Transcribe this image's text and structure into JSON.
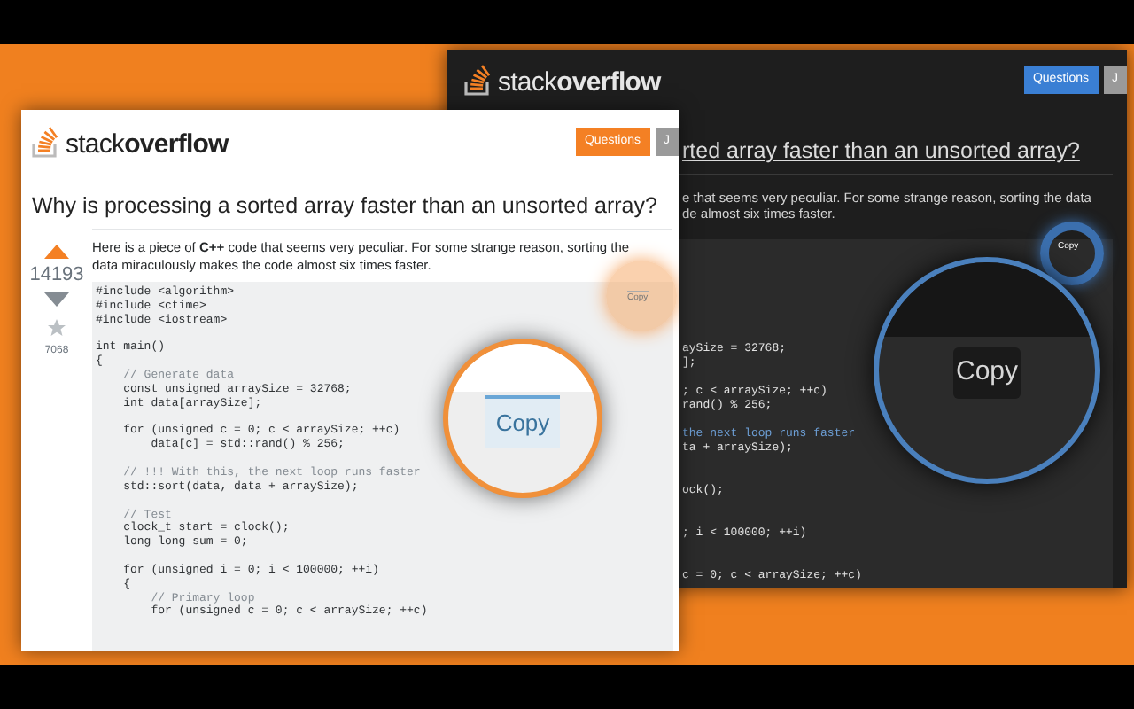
{
  "dark_window": {
    "logo": "stack**overflow**",
    "nav_buttons": [
      {
        "label": "Questions",
        "selected": true
      },
      {
        "label": "J",
        "selected": false
      }
    ],
    "question_title": "rted array faster than an unsorted array?",
    "question_body": [
      "e that seems very peculiar. For some strange reason, sorting the data",
      "de almost six times faster."
    ],
    "copy_button": "Copy",
    "magnified_copy_button": "Copy",
    "code_fragments": [
      {
        "text": "aySize = 32768;",
        "kind": "code"
      },
      {
        "text": "];",
        "kind": "code"
      },
      {
        "text": "; c < arraySize; ++c)",
        "kind": "code"
      },
      {
        "text": "rand() % 256;",
        "kind": "code"
      },
      {
        "text": "the next loop runs faster",
        "kind": "comment"
      },
      {
        "text": "ta + arraySize);",
        "kind": "code"
      },
      {
        "text": "ock();",
        "kind": "code"
      },
      {
        "text": "; i < 100000; ++i)",
        "kind": "code"
      },
      {
        "text": "c = 0; c < arraySize; ++c)",
        "kind": "code"
      }
    ]
  },
  "light_window": {
    "logo": "stack**overflow**",
    "nav_buttons": [
      {
        "label": "Questions",
        "selected": true
      },
      {
        "label": "J",
        "selected": false
      }
    ],
    "question_title": "Why is processing a sorted array faster than an unsorted array?",
    "votes": {
      "score": "14193",
      "upvoted": true,
      "downvoted": false,
      "favorited": false,
      "favorites": "7068"
    },
    "question_body": "Here is a piece of **C++** code that seems very peculiar. For some strange reason, sorting the data miraculously makes the code almost six times faster.",
    "copy_button": "Copy",
    "magnified_copy_button": "Copy",
    "code_blocks": [
      [
        {
          "text": "#include <algorithm>",
          "kind": "code"
        },
        {
          "text": "#include <ctime>",
          "kind": "code"
        },
        {
          "text": "#include <iostream>",
          "kind": "code"
        }
      ],
      [
        {
          "text": "int main()",
          "kind": "code"
        },
        {
          "text": "{",
          "kind": "code"
        },
        {
          "text": "    // Generate data",
          "kind": "comment"
        },
        {
          "text": "    const unsigned arraySize = 32768;",
          "kind": "code"
        },
        {
          "text": "    int data[arraySize];",
          "kind": "code"
        }
      ],
      [
        {
          "text": "    for (unsigned c = 0; c < arraySize; ++c)",
          "kind": "code"
        },
        {
          "text": "        data[c] = std::rand() % 256;",
          "kind": "code"
        }
      ],
      [
        {
          "text": "    // !!! With this, the next loop runs faster",
          "kind": "comment"
        },
        {
          "text": "    std::sort(data, data + arraySize);",
          "kind": "code"
        }
      ],
      [
        {
          "text": "    // Test",
          "kind": "comment"
        },
        {
          "text": "    clock_t start = clock();",
          "kind": "code"
        },
        {
          "text": "    long long sum = 0;",
          "kind": "code"
        }
      ],
      [
        {
          "text": "    for (unsigned i = 0; i < 100000; ++i)",
          "kind": "code"
        },
        {
          "text": "    {",
          "kind": "code"
        },
        {
          "text": "        // Primary loop",
          "kind": "comment"
        },
        {
          "text": "        for (unsigned c = 0; c < arraySize; ++c)",
          "kind": "code"
        }
      ]
    ]
  }
}
